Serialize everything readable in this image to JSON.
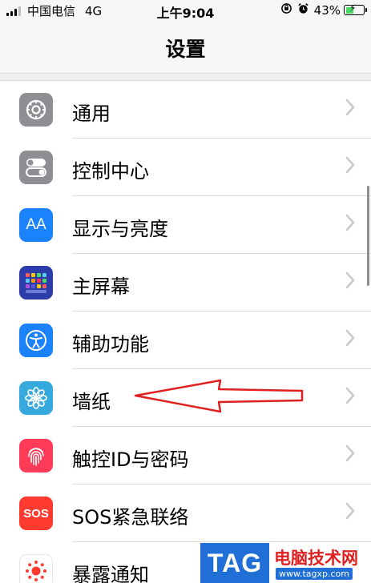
{
  "status_bar": {
    "carrier": "中国电信",
    "network": "4G",
    "time": "上午9:04",
    "battery": "43%"
  },
  "nav": {
    "title": "设置"
  },
  "settings": {
    "items": [
      {
        "label": "通用",
        "icon": "gear-icon",
        "color": "#8e8e93"
      },
      {
        "label": "控制中心",
        "icon": "toggle-switches-icon",
        "color": "#8e8e93"
      },
      {
        "label": "显示与亮度",
        "icon": "text-size-icon",
        "icon_text": "AA",
        "color": "#1a82fb"
      },
      {
        "label": "主屏幕",
        "icon": "home-screen-grid-icon",
        "color": "#2c3ca8"
      },
      {
        "label": "辅助功能",
        "icon": "accessibility-icon",
        "color": "#1a82fb"
      },
      {
        "label": "墙纸",
        "icon": "wallpaper-flower-icon",
        "color": "#36aadc"
      },
      {
        "label": "触控ID与密码",
        "icon": "fingerprint-icon",
        "color": "#ff3b57"
      },
      {
        "label": "SOS紧急联络",
        "icon": "sos-icon",
        "icon_text": "SOS",
        "color": "#ff3b30"
      },
      {
        "label": "暴露通知",
        "icon": "exposure-notification-icon",
        "color": "#ff3b30"
      }
    ]
  },
  "watermark": {
    "tag": "TAG",
    "title": "电脑技术网",
    "url": "www.tagxp.com"
  }
}
